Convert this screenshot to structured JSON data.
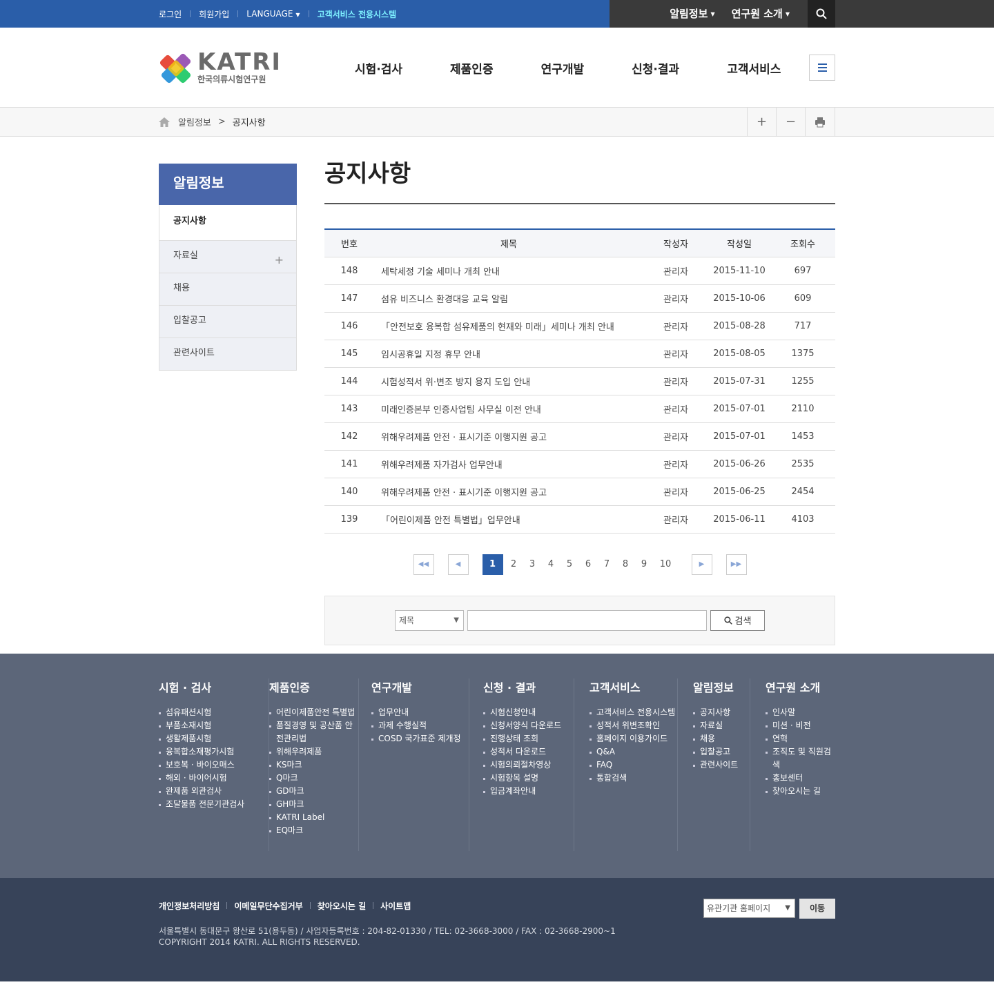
{
  "topbar": {
    "login": "로그인",
    "join": "회원가입",
    "language": "LANGUAGE",
    "customer_system": "고객서비스 전용시스템",
    "menu_notice": "알림정보",
    "menu_about": "연구원 소개"
  },
  "logo": {
    "en": "KATRI",
    "ko": "한국의류시험연구원"
  },
  "gnb": [
    "시험·검사",
    "제품인증",
    "연구개발",
    "신청·결과",
    "고객서비스"
  ],
  "location": {
    "parent": "알림정보",
    "current": "공지사항",
    "zoom_in": "+",
    "zoom_out": "−"
  },
  "lnb": {
    "title": "알림정보",
    "items": [
      "공지사항",
      "자료실",
      "채용",
      "입찰공고",
      "관련사이트"
    ],
    "expand": "+"
  },
  "page_title": "공지사항",
  "table": {
    "headers": [
      "번호",
      "제목",
      "작성자",
      "작성일",
      "조회수"
    ],
    "rows": [
      [
        "148",
        "세탁세정 기술 세미나 개최 안내",
        "관리자",
        "2015-11-10",
        "697"
      ],
      [
        "147",
        "섬유 비즈니스 환경대응 교육 알림",
        "관리자",
        "2015-10-06",
        "609"
      ],
      [
        "146",
        "「안전보호 융복합 섬유제품의 현재와 미래」세미나 개최 안내",
        "관리자",
        "2015-08-28",
        "717"
      ],
      [
        "145",
        "임시공휴일 지정 휴무 안내",
        "관리자",
        "2015-08-05",
        "1375"
      ],
      [
        "144",
        "시험성적서 위·변조 방지 용지 도입 안내",
        "관리자",
        "2015-07-31",
        "1255"
      ],
      [
        "143",
        "미래인증본부 인증사업팀 사무실 이전 안내",
        "관리자",
        "2015-07-01",
        "2110"
      ],
      [
        "142",
        "위해우려제품 안전 · 표시기준 이행지원 공고",
        "관리자",
        "2015-07-01",
        "1453"
      ],
      [
        "141",
        "위해우려제품 자가검사 업무안내",
        "관리자",
        "2015-06-26",
        "2535"
      ],
      [
        "140",
        "위해우려제품 안전 · 표시기준 이행지원 공고",
        "관리자",
        "2015-06-25",
        "2454"
      ],
      [
        "139",
        "「어린이제품 안전 특별법」업무안내",
        "관리자",
        "2015-06-11",
        "4103"
      ]
    ]
  },
  "paging": {
    "current": "1",
    "pages": [
      "2",
      "3",
      "4",
      "5",
      "6",
      "7",
      "8",
      "9",
      "10"
    ]
  },
  "search": {
    "select_value": "제목",
    "button": "검색"
  },
  "sitemap": [
    {
      "title": "시험 · 검사",
      "items": [
        "섬유패션시험",
        "부품소재시험",
        "생활제품시험",
        "융복합소재평가시험",
        "보호복 · 바이오매스",
        "해외 · 바이어시험",
        "완제품 외관검사",
        "조달물품 전문기관검사"
      ]
    },
    {
      "title": "제품인증",
      "items": [
        "어린이제품안전 특별법",
        "품질경영 및 공산품 안전관리법",
        "위해우려제품",
        "KS마크",
        "Q마크",
        "GD마크",
        "GH마크",
        "KATRI Label",
        "EQ마크"
      ]
    },
    {
      "title": "연구개발",
      "items": [
        "업무안내",
        "과제 수행실적",
        "COSD 국가표준 제개정"
      ]
    },
    {
      "title": "신청 · 결과",
      "items": [
        "시험신청안내",
        "신청서양식 다운로드",
        "진행상태 조회",
        "성적서 다운로드",
        "시험의뢰절차영상",
        "시험항목 설명",
        "입금계좌안내"
      ]
    },
    {
      "title": "고객서비스",
      "items": [
        "고객서비스 전용시스템",
        "성적서 위변조확인",
        "홈페이지 이용가이드",
        "Q&A",
        "FAQ",
        "통합검색"
      ]
    },
    {
      "title": "알림정보",
      "items": [
        "공지사항",
        "자료실",
        "채용",
        "입찰공고",
        "관련사이트"
      ]
    },
    {
      "title": "연구원 소개",
      "items": [
        "인사말",
        "미션 · 비전",
        "연혁",
        "조직도 및 직원검색",
        "홍보센터",
        "찾아오시는 길"
      ]
    }
  ],
  "footer": {
    "links": [
      "개인정보처리방침",
      "이메일무단수집거부",
      "찾아오시는 길",
      "사이트맵"
    ],
    "address": "서울특별시 동대문구 왕산로 51(용두동) / 사업자등록번호 : 204-82-01330 / TEL: 02-3668-3000 / FAX : 02-3668-2900~1",
    "copyright": "COPYRIGHT 2014 KATRI. ALL RIGHTS RESERVED.",
    "family_select": "유관기관 홈페이지",
    "go": "이동"
  },
  "colors": {
    "primary": "#2a5ea9",
    "lnb_head": "#4966aa",
    "footer_map": "#5c6679",
    "footer_bottom": "#374359"
  }
}
